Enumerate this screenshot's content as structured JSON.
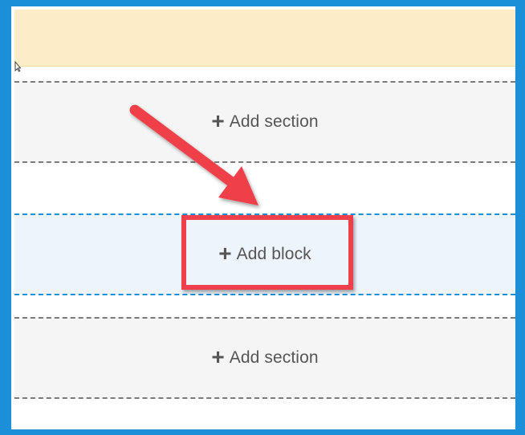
{
  "sections": [
    {
      "add_label": "Add section",
      "plus_glyph": "+"
    },
    {
      "add_label": "Add section",
      "plus_glyph": "+"
    }
  ],
  "block_region": {
    "add_label": "Add block",
    "plus_glyph": "+"
  },
  "colors": {
    "frame_border": "#1b8fd8",
    "header_band": "#fdecc8",
    "section_bg": "#f5f5f5",
    "region_bg": "#eef4fb",
    "highlight": "#ef3f4a"
  },
  "icons": {
    "annotation_arrow": "arrow-annotation-icon",
    "cursor": "mouse-cursor-icon"
  }
}
